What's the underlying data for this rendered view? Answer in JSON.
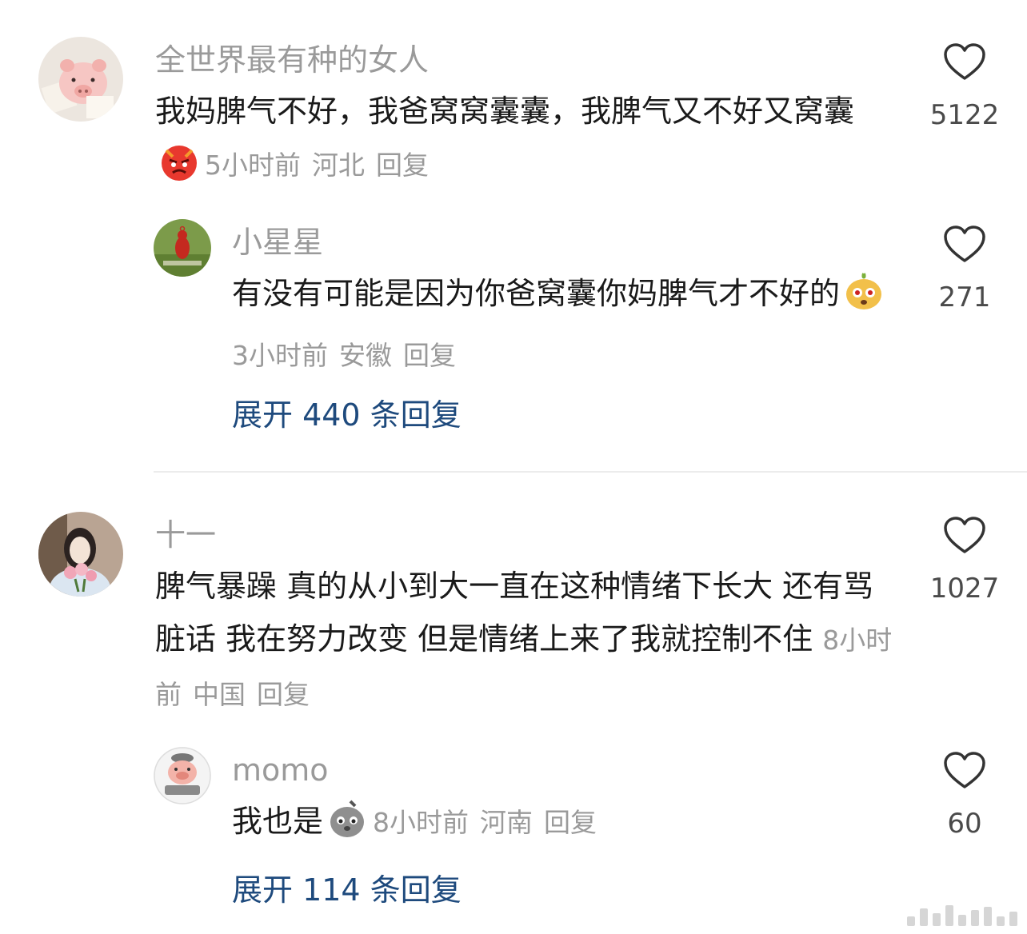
{
  "comments": [
    {
      "username": "全世界最有种的女人",
      "content": "我妈脾气不好，我爸窝窝囊囊，我脾气又不好又窝囊",
      "emoji": "angry-face-icon",
      "time": "5小时前",
      "location": "河北",
      "reply_label": "回复",
      "likes": "5122",
      "replies": [
        {
          "username": "小星星",
          "content": "有没有可能是因为你爸窝囊你妈脾气才不好的",
          "emoji": "shocked-fox-icon",
          "time": "3小时前",
          "location": "安徽",
          "reply_label": "回复",
          "likes": "271"
        }
      ],
      "expand_label": "展开 440 条回复"
    },
    {
      "username": "十一",
      "content": "脾气暴躁 真的从小到大一直在这种情绪下长大 还有骂脏话 我在努力改变 但是情绪上来了我就控制不住",
      "time": "8小时前",
      "location": "中国",
      "reply_label": "回复",
      "likes": "1027",
      "replies": [
        {
          "username": "momo",
          "content": "我也是",
          "emoji": "sad-bird-icon",
          "time": "8小时前",
          "location": "河南",
          "reply_label": "回复",
          "likes": "60"
        }
      ],
      "expand_label": "展开 114 条回复"
    }
  ],
  "colors": {
    "username": "#9a9a9a",
    "text": "#1a1a1a",
    "meta": "#9a9a9a",
    "expand_link": "#1e4a7d",
    "divider": "#ececec"
  }
}
